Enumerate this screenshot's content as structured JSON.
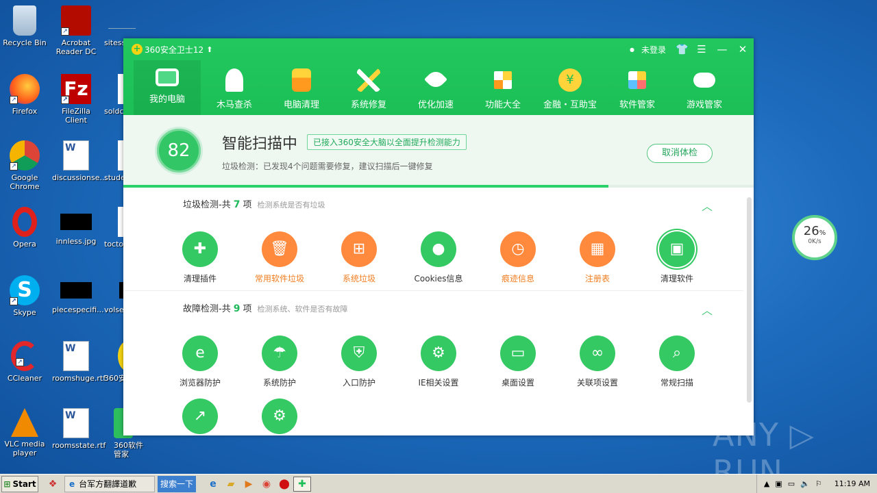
{
  "desktop": {
    "icons": [
      {
        "label": "Recycle Bin"
      },
      {
        "label": "Acrobat Reader DC"
      },
      {
        "label": "sitess"
      },
      {
        "label": "Firefox"
      },
      {
        "label": "FileZilla Client"
      },
      {
        "label": "soldc"
      },
      {
        "label": "Google Chrome"
      },
      {
        "label": "discussionse..."
      },
      {
        "label": "stude"
      },
      {
        "label": "Opera"
      },
      {
        "label": "innless.jpg"
      },
      {
        "label": "tocto"
      },
      {
        "label": "Skype"
      },
      {
        "label": "piecespecifi..."
      },
      {
        "label": "volse"
      },
      {
        "label": "CCleaner"
      },
      {
        "label": "roomshuge.rtf"
      },
      {
        "label": "360安"
      },
      {
        "label": "VLC media player"
      },
      {
        "label": "roomsstate.rtf"
      },
      {
        "label": "360软件管家"
      }
    ]
  },
  "app": {
    "title": "360安全卫士12",
    "login": "未登录",
    "nav": [
      {
        "label": "我的电脑",
        "icon": "monitor-icon"
      },
      {
        "label": "木马查杀",
        "icon": "horse-icon"
      },
      {
        "label": "电脑清理",
        "icon": "broom-icon"
      },
      {
        "label": "系统修复",
        "icon": "tools-icon"
      },
      {
        "label": "优化加速",
        "icon": "rocket-icon"
      },
      {
        "label": "功能大全",
        "icon": "grid-icon"
      },
      {
        "label": "金融・互助宝",
        "icon": "coin-icon"
      },
      {
        "label": "软件管家",
        "icon": "apps-icon"
      },
      {
        "label": "游戏管家",
        "icon": "gamepad-icon"
      }
    ],
    "scan": {
      "score": "82",
      "title": "智能扫描中",
      "tag": "已接入360安全大脑以全面提升检测能力",
      "subtitle": "垃圾检测：已发现4个问题需要修复，建议扫描后一键修复",
      "cancel": "取消体检",
      "progress": 0.77
    },
    "junk": {
      "title_prefix": "垃圾检测-共",
      "count": "7",
      "unit": "项",
      "desc": "检测系统是否有垃圾",
      "items": [
        {
          "label": "清理插件"
        },
        {
          "label": "常用软件垃圾"
        },
        {
          "label": "系统垃圾"
        },
        {
          "label": "Cookies信息"
        },
        {
          "label": "痕迹信息"
        },
        {
          "label": "注册表"
        },
        {
          "label": "清理软件"
        }
      ]
    },
    "fault": {
      "title_prefix": "故障检测-共",
      "count": "9",
      "unit": "项",
      "desc": "检测系统、软件是否有故障",
      "items": [
        {
          "label": "浏览器防护"
        },
        {
          "label": "系统防护"
        },
        {
          "label": "入口防护"
        },
        {
          "label": "IE相关设置"
        },
        {
          "label": "桌面设置"
        },
        {
          "label": "关联项设置"
        },
        {
          "label": "常规扫描"
        }
      ]
    }
  },
  "speed_widget": {
    "percent": "26",
    "percent_unit": "%",
    "rate": "0K/s"
  },
  "watermark": "ANY ▷ RUN",
  "taskbar": {
    "start": "Start",
    "task_label": "台军方翻譯道歉",
    "search": "搜索一下",
    "time": "11:19 AM"
  }
}
